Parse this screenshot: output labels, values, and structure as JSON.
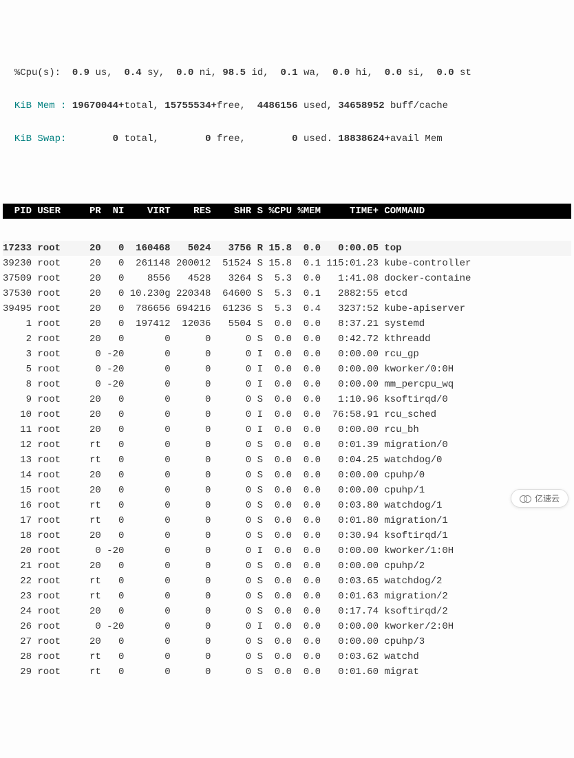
{
  "summary": {
    "cpu_line": {
      "prefix": "%Cpu(s):",
      "us": "0.9",
      "us_lbl": "us,",
      "sy": "0.4",
      "sy_lbl": "sy,",
      "ni": "0.0",
      "ni_lbl": "ni,",
      "id": "98.5",
      "id_lbl": "id,",
      "wa": "0.1",
      "wa_lbl": "wa,",
      "hi": "0.0",
      "hi_lbl": "hi,",
      "si": "0.0",
      "si_lbl": "si,",
      "st": "0.0",
      "st_lbl": "st"
    },
    "mem_line": {
      "prefix": "KiB Mem :",
      "total": "19670044+",
      "total_lbl": "total,",
      "free": "15755534+",
      "free_lbl": "free,",
      "used": "4486156",
      "used_lbl": "used,",
      "buff": "34658952",
      "buff_lbl": "buff/cache"
    },
    "swap_line": {
      "prefix": "KiB Swap:",
      "total": "0",
      "total_lbl": "total,",
      "free": "0",
      "free_lbl": "free,",
      "used": "0",
      "used_lbl": "used.",
      "avail": "18838624+",
      "avail_lbl": "avail Mem"
    }
  },
  "headers": {
    "pid": "PID",
    "user": "USER",
    "pr": "PR",
    "ni": "NI",
    "virt": "VIRT",
    "res": "RES",
    "shr": "SHR",
    "s": "S",
    "cpu": "%CPU",
    "mem": "%MEM",
    "time": "TIME+",
    "cmd": "COMMAND"
  },
  "rows": [
    {
      "pid": "17233",
      "user": "root",
      "pr": "20",
      "ni": "0",
      "virt": "160468",
      "res": "5024",
      "shr": "3756",
      "s": "R",
      "cpu": "15.8",
      "mem": "0.0",
      "time": "0:00.05",
      "cmd": "top",
      "bold": true
    },
    {
      "pid": "39230",
      "user": "root",
      "pr": "20",
      "ni": "0",
      "virt": "261148",
      "res": "200012",
      "shr": "51524",
      "s": "S",
      "cpu": "15.8",
      "mem": "0.1",
      "time": "115:01.23",
      "cmd": "kube-controller"
    },
    {
      "pid": "37509",
      "user": "root",
      "pr": "20",
      "ni": "0",
      "virt": "8556",
      "res": "4528",
      "shr": "3264",
      "s": "S",
      "cpu": "5.3",
      "mem": "0.0",
      "time": "1:41.08",
      "cmd": "docker-containe"
    },
    {
      "pid": "37530",
      "user": "root",
      "pr": "20",
      "ni": "0",
      "virt": "10.230g",
      "res": "220348",
      "shr": "64600",
      "s": "S",
      "cpu": "5.3",
      "mem": "0.1",
      "time": "2882:55",
      "cmd": "etcd"
    },
    {
      "pid": "39495",
      "user": "root",
      "pr": "20",
      "ni": "0",
      "virt": "786656",
      "res": "694216",
      "shr": "61236",
      "s": "S",
      "cpu": "5.3",
      "mem": "0.4",
      "time": "3237:52",
      "cmd": "kube-apiserver"
    },
    {
      "pid": "1",
      "user": "root",
      "pr": "20",
      "ni": "0",
      "virt": "197412",
      "res": "12036",
      "shr": "5504",
      "s": "S",
      "cpu": "0.0",
      "mem": "0.0",
      "time": "8:37.21",
      "cmd": "systemd"
    },
    {
      "pid": "2",
      "user": "root",
      "pr": "20",
      "ni": "0",
      "virt": "0",
      "res": "0",
      "shr": "0",
      "s": "S",
      "cpu": "0.0",
      "mem": "0.0",
      "time": "0:42.72",
      "cmd": "kthreadd"
    },
    {
      "pid": "3",
      "user": "root",
      "pr": "0",
      "ni": "-20",
      "virt": "0",
      "res": "0",
      "shr": "0",
      "s": "I",
      "cpu": "0.0",
      "mem": "0.0",
      "time": "0:00.00",
      "cmd": "rcu_gp"
    },
    {
      "pid": "5",
      "user": "root",
      "pr": "0",
      "ni": "-20",
      "virt": "0",
      "res": "0",
      "shr": "0",
      "s": "I",
      "cpu": "0.0",
      "mem": "0.0",
      "time": "0:00.00",
      "cmd": "kworker/0:0H"
    },
    {
      "pid": "8",
      "user": "root",
      "pr": "0",
      "ni": "-20",
      "virt": "0",
      "res": "0",
      "shr": "0",
      "s": "I",
      "cpu": "0.0",
      "mem": "0.0",
      "time": "0:00.00",
      "cmd": "mm_percpu_wq"
    },
    {
      "pid": "9",
      "user": "root",
      "pr": "20",
      "ni": "0",
      "virt": "0",
      "res": "0",
      "shr": "0",
      "s": "S",
      "cpu": "0.0",
      "mem": "0.0",
      "time": "1:10.96",
      "cmd": "ksoftirqd/0"
    },
    {
      "pid": "10",
      "user": "root",
      "pr": "20",
      "ni": "0",
      "virt": "0",
      "res": "0",
      "shr": "0",
      "s": "I",
      "cpu": "0.0",
      "mem": "0.0",
      "time": "76:58.91",
      "cmd": "rcu_sched"
    },
    {
      "pid": "11",
      "user": "root",
      "pr": "20",
      "ni": "0",
      "virt": "0",
      "res": "0",
      "shr": "0",
      "s": "I",
      "cpu": "0.0",
      "mem": "0.0",
      "time": "0:00.00",
      "cmd": "rcu_bh"
    },
    {
      "pid": "12",
      "user": "root",
      "pr": "rt",
      "ni": "0",
      "virt": "0",
      "res": "0",
      "shr": "0",
      "s": "S",
      "cpu": "0.0",
      "mem": "0.0",
      "time": "0:01.39",
      "cmd": "migration/0"
    },
    {
      "pid": "13",
      "user": "root",
      "pr": "rt",
      "ni": "0",
      "virt": "0",
      "res": "0",
      "shr": "0",
      "s": "S",
      "cpu": "0.0",
      "mem": "0.0",
      "time": "0:04.25",
      "cmd": "watchdog/0"
    },
    {
      "pid": "14",
      "user": "root",
      "pr": "20",
      "ni": "0",
      "virt": "0",
      "res": "0",
      "shr": "0",
      "s": "S",
      "cpu": "0.0",
      "mem": "0.0",
      "time": "0:00.00",
      "cmd": "cpuhp/0"
    },
    {
      "pid": "15",
      "user": "root",
      "pr": "20",
      "ni": "0",
      "virt": "0",
      "res": "0",
      "shr": "0",
      "s": "S",
      "cpu": "0.0",
      "mem": "0.0",
      "time": "0:00.00",
      "cmd": "cpuhp/1"
    },
    {
      "pid": "16",
      "user": "root",
      "pr": "rt",
      "ni": "0",
      "virt": "0",
      "res": "0",
      "shr": "0",
      "s": "S",
      "cpu": "0.0",
      "mem": "0.0",
      "time": "0:03.80",
      "cmd": "watchdog/1"
    },
    {
      "pid": "17",
      "user": "root",
      "pr": "rt",
      "ni": "0",
      "virt": "0",
      "res": "0",
      "shr": "0",
      "s": "S",
      "cpu": "0.0",
      "mem": "0.0",
      "time": "0:01.80",
      "cmd": "migration/1"
    },
    {
      "pid": "18",
      "user": "root",
      "pr": "20",
      "ni": "0",
      "virt": "0",
      "res": "0",
      "shr": "0",
      "s": "S",
      "cpu": "0.0",
      "mem": "0.0",
      "time": "0:30.94",
      "cmd": "ksoftirqd/1"
    },
    {
      "pid": "20",
      "user": "root",
      "pr": "0",
      "ni": "-20",
      "virt": "0",
      "res": "0",
      "shr": "0",
      "s": "I",
      "cpu": "0.0",
      "mem": "0.0",
      "time": "0:00.00",
      "cmd": "kworker/1:0H"
    },
    {
      "pid": "21",
      "user": "root",
      "pr": "20",
      "ni": "0",
      "virt": "0",
      "res": "0",
      "shr": "0",
      "s": "S",
      "cpu": "0.0",
      "mem": "0.0",
      "time": "0:00.00",
      "cmd": "cpuhp/2"
    },
    {
      "pid": "22",
      "user": "root",
      "pr": "rt",
      "ni": "0",
      "virt": "0",
      "res": "0",
      "shr": "0",
      "s": "S",
      "cpu": "0.0",
      "mem": "0.0",
      "time": "0:03.65",
      "cmd": "watchdog/2"
    },
    {
      "pid": "23",
      "user": "root",
      "pr": "rt",
      "ni": "0",
      "virt": "0",
      "res": "0",
      "shr": "0",
      "s": "S",
      "cpu": "0.0",
      "mem": "0.0",
      "time": "0:01.63",
      "cmd": "migration/2"
    },
    {
      "pid": "24",
      "user": "root",
      "pr": "20",
      "ni": "0",
      "virt": "0",
      "res": "0",
      "shr": "0",
      "s": "S",
      "cpu": "0.0",
      "mem": "0.0",
      "time": "0:17.74",
      "cmd": "ksoftirqd/2"
    },
    {
      "pid": "26",
      "user": "root",
      "pr": "0",
      "ni": "-20",
      "virt": "0",
      "res": "0",
      "shr": "0",
      "s": "I",
      "cpu": "0.0",
      "mem": "0.0",
      "time": "0:00.00",
      "cmd": "kworker/2:0H"
    },
    {
      "pid": "27",
      "user": "root",
      "pr": "20",
      "ni": "0",
      "virt": "0",
      "res": "0",
      "shr": "0",
      "s": "S",
      "cpu": "0.0",
      "mem": "0.0",
      "time": "0:00.00",
      "cmd": "cpuhp/3"
    },
    {
      "pid": "28",
      "user": "root",
      "pr": "rt",
      "ni": "0",
      "virt": "0",
      "res": "0",
      "shr": "0",
      "s": "S",
      "cpu": "0.0",
      "mem": "0.0",
      "time": "0:03.62",
      "cmd": "watchd"
    },
    {
      "pid": "29",
      "user": "root",
      "pr": "rt",
      "ni": "0",
      "virt": "0",
      "res": "0",
      "shr": "0",
      "s": "S",
      "cpu": "0.0",
      "mem": "0.0",
      "time": "0:01.60",
      "cmd": "migrat"
    }
  ],
  "watermark": "亿速云"
}
